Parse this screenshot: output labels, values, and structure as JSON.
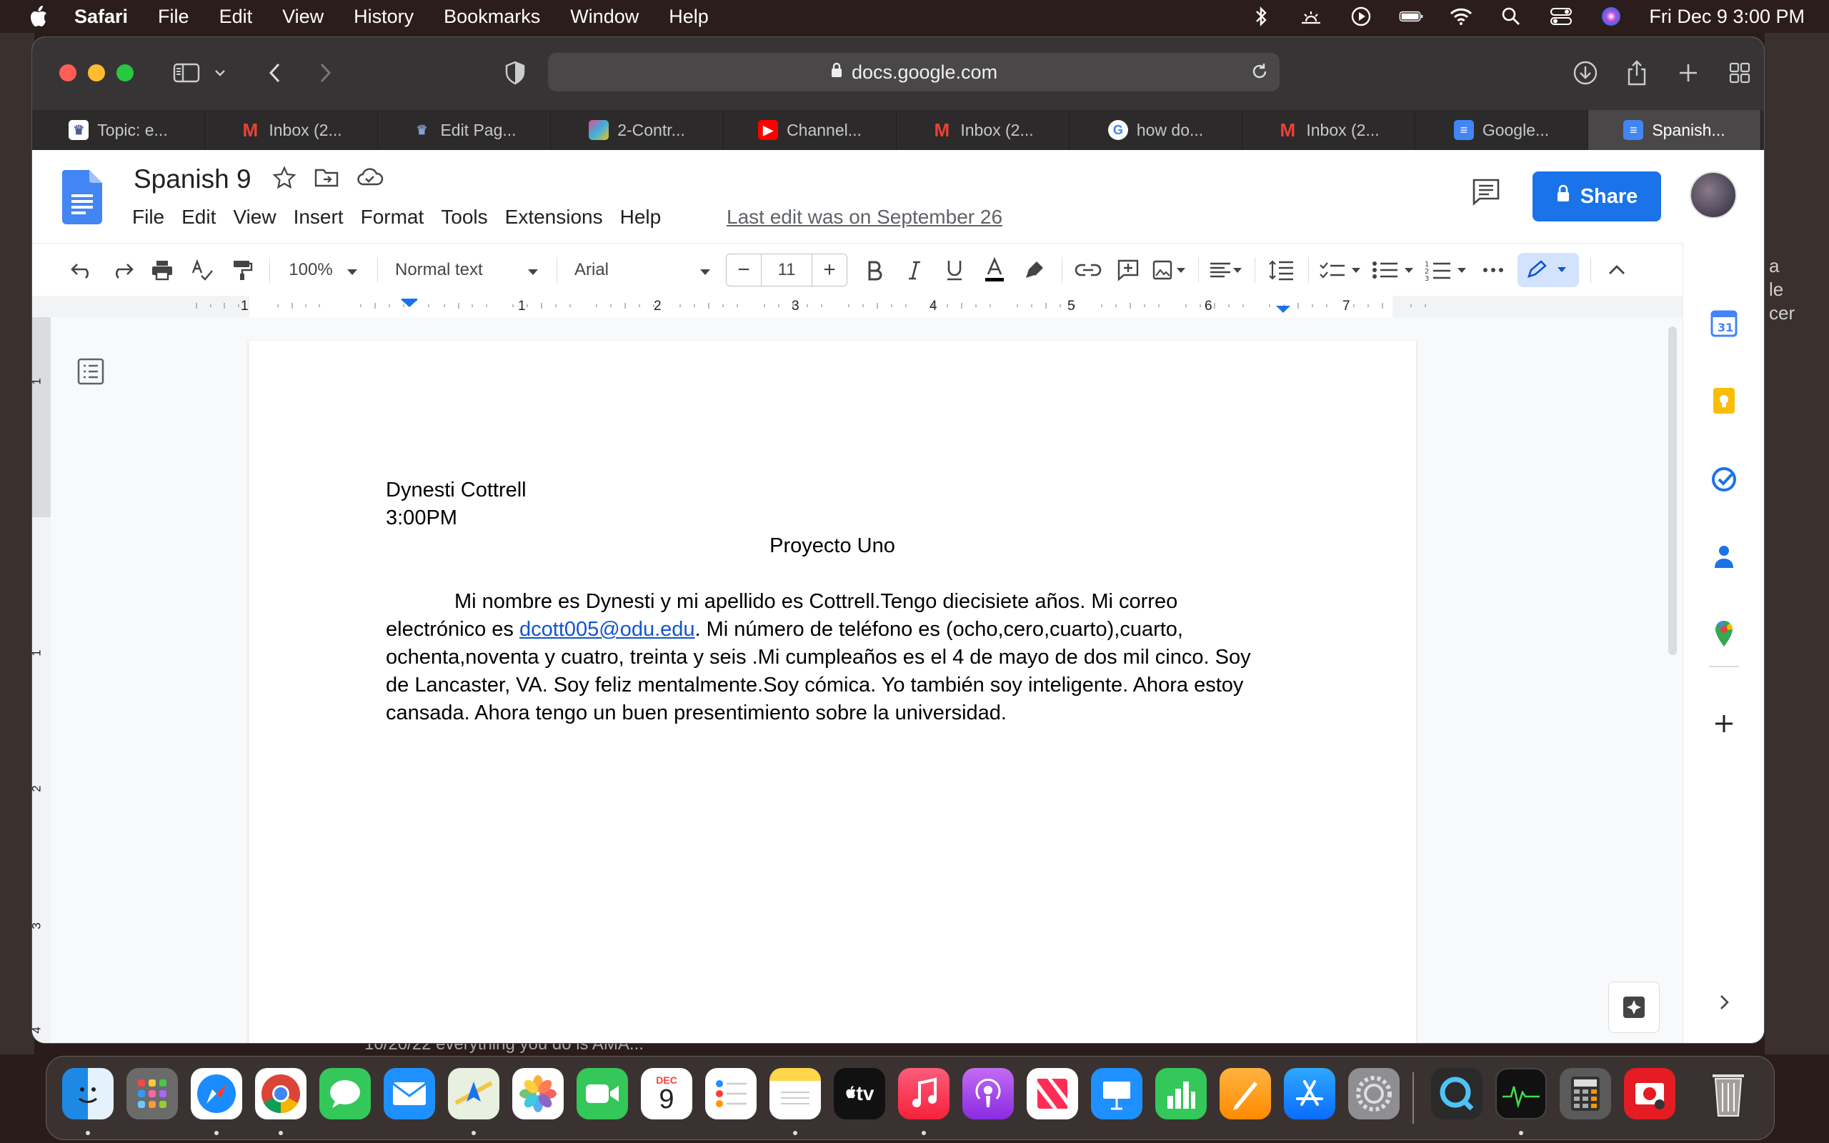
{
  "menubar": {
    "app": "Safari",
    "items": [
      "File",
      "Edit",
      "View",
      "History",
      "Bookmarks",
      "Window",
      "Help"
    ],
    "clock": "Fri Dec 9  3:00 PM"
  },
  "browser": {
    "url": "docs.google.com",
    "tabs": [
      {
        "label": "Topic: e...",
        "icon": "crown-icon",
        "color": "#4a5a9a"
      },
      {
        "label": "Inbox (2...",
        "icon": "gmail-icon",
        "color": "#ea4335"
      },
      {
        "label": "Edit Pag...",
        "icon": "edit-page-icon",
        "color": "#5a6a8a"
      },
      {
        "label": "2-Contr...",
        "icon": "colorful-logo-icon",
        "color": "#e94b8a"
      },
      {
        "label": "Channel...",
        "icon": "youtube-icon",
        "color": "#ff0000"
      },
      {
        "label": "Inbox (2...",
        "icon": "gmail-icon",
        "color": "#ea4335"
      },
      {
        "label": "how do...",
        "icon": "google-icon",
        "color": "#4285f4"
      },
      {
        "label": "Inbox (2...",
        "icon": "gmail-icon",
        "color": "#ea4335"
      },
      {
        "label": "Google...",
        "icon": "google-docs-icon",
        "color": "#4285f4"
      },
      {
        "label": "Spanish...",
        "icon": "google-docs-icon",
        "color": "#4285f4"
      }
    ]
  },
  "docs": {
    "title": "Spanish 9",
    "menu": [
      "File",
      "Edit",
      "View",
      "Insert",
      "Format",
      "Tools",
      "Extensions",
      "Help"
    ],
    "last_edit": "Last edit was on September 26",
    "share_label": "Share",
    "toolbar": {
      "zoom": "100%",
      "style": "Normal text",
      "font": "Arial",
      "font_size": "11",
      "minus": "−",
      "plus": "+"
    },
    "ruler_labels": [
      "1",
      "1",
      "2",
      "3",
      "4",
      "5",
      "6",
      "7"
    ],
    "vruler_labels": [
      "1",
      "1",
      "2",
      "3",
      "4"
    ],
    "content": {
      "line1": "Dynesti Cottrell",
      "line2": "3:00PM",
      "heading": "Proyecto Uno",
      "body_part1": "Mi nombre es Dynesti y mi apellido es Cottrell.Tengo diecisiete años. Mi correo electrónico es ",
      "email": "dcott005@odu.edu",
      "body_part2": ". Mi número de teléfono es (ocho,cero,cuarto),cuarto, ochenta,noventa y cuatro, treinta y seis .Mi cumpleaños es el 4 de mayo de dos mil cinco. Soy de Lancaster, VA. Soy feliz mentalmente.Soy cómica. Yo también soy inteligente. Ahora estoy cansada. Ahora tengo un buen presentimiento sobre la universidad."
    }
  },
  "background": {
    "right_text": [
      "a",
      "le",
      "cer"
    ],
    "bottom_text": "10/20/22  everything you do is AMA..."
  },
  "dock": {
    "calendar_month": "DEC",
    "calendar_day": "9",
    "tv_label": "tv"
  }
}
